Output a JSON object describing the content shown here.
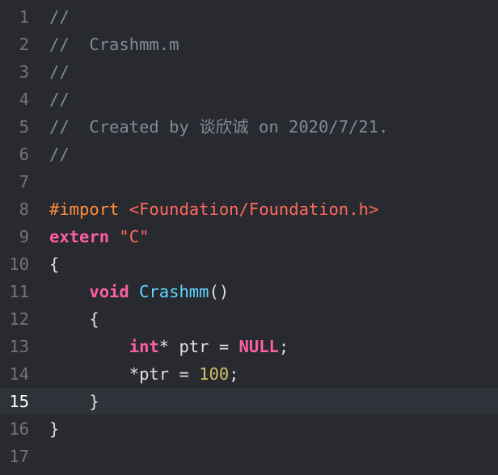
{
  "colors": {
    "background": "#292a30",
    "current_line": "#2f3239",
    "comment": "#7f8c98",
    "directive": "#fd8f3f",
    "keyword": "#fc5fa3",
    "string": "#fc6a5d",
    "plain": "#dfdfe0",
    "function_declaration": "#5dd8ff",
    "number": "#d0bf69",
    "line_number": "#747478"
  },
  "editor": {
    "current_line": 15,
    "lines": [
      {
        "number": "1",
        "tokens": [
          {
            "type": "comment",
            "text": "//"
          }
        ]
      },
      {
        "number": "2",
        "tokens": [
          {
            "type": "comment",
            "text": "//  Crashmm.m"
          }
        ]
      },
      {
        "number": "3",
        "tokens": [
          {
            "type": "comment",
            "text": "//"
          }
        ]
      },
      {
        "number": "4",
        "tokens": [
          {
            "type": "comment",
            "text": "//"
          }
        ]
      },
      {
        "number": "5",
        "tokens": [
          {
            "type": "comment",
            "text": "//  Created by 谈欣诚 on 2020/7/21."
          }
        ]
      },
      {
        "number": "6",
        "tokens": [
          {
            "type": "comment",
            "text": "//"
          }
        ]
      },
      {
        "number": "7",
        "tokens": []
      },
      {
        "number": "8",
        "tokens": [
          {
            "type": "directive",
            "text": "#import"
          },
          {
            "type": "plain",
            "text": " "
          },
          {
            "type": "string",
            "text": "<Foundation/Foundation.h>"
          }
        ]
      },
      {
        "number": "9",
        "tokens": [
          {
            "type": "keyword",
            "text": "extern"
          },
          {
            "type": "plain",
            "text": " "
          },
          {
            "type": "string",
            "text": "\"C\""
          }
        ]
      },
      {
        "number": "10",
        "tokens": [
          {
            "type": "plain",
            "text": "{"
          }
        ]
      },
      {
        "number": "11",
        "tokens": [
          {
            "type": "plain",
            "text": "    "
          },
          {
            "type": "keyword",
            "text": "void"
          },
          {
            "type": "plain",
            "text": " "
          },
          {
            "type": "funcdecl",
            "text": "Crashmm"
          },
          {
            "type": "plain",
            "text": "()"
          }
        ]
      },
      {
        "number": "12",
        "tokens": [
          {
            "type": "plain",
            "text": "    {"
          }
        ]
      },
      {
        "number": "13",
        "tokens": [
          {
            "type": "plain",
            "text": "        "
          },
          {
            "type": "keyword",
            "text": "int"
          },
          {
            "type": "plain",
            "text": "* ptr = "
          },
          {
            "type": "keyword",
            "text": "NULL"
          },
          {
            "type": "plain",
            "text": ";"
          }
        ]
      },
      {
        "number": "14",
        "tokens": [
          {
            "type": "plain",
            "text": "        *ptr = "
          },
          {
            "type": "number",
            "text": "100"
          },
          {
            "type": "plain",
            "text": ";"
          }
        ]
      },
      {
        "number": "15",
        "tokens": [
          {
            "type": "plain",
            "text": "    }"
          }
        ]
      },
      {
        "number": "16",
        "tokens": [
          {
            "type": "plain",
            "text": "}"
          }
        ]
      },
      {
        "number": "17",
        "tokens": []
      }
    ]
  }
}
